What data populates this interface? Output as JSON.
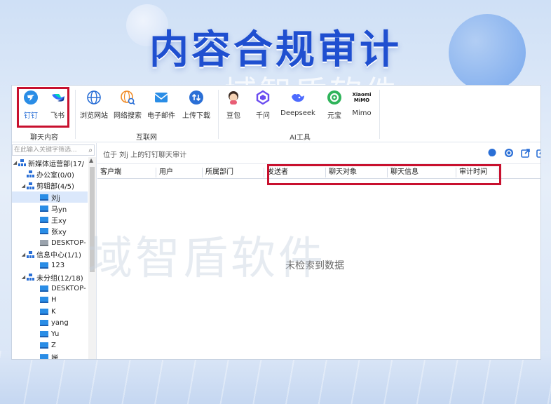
{
  "banner": {
    "title": "内容合规审计",
    "watermark_top": "域智盾软件"
  },
  "ribbon": {
    "groups": [
      {
        "label": "聊天内容",
        "items": [
          {
            "label": "钉钉",
            "icon": "dingtalk-icon"
          },
          {
            "label": "飞书",
            "icon": "feishu-icon"
          }
        ]
      },
      {
        "label": "互联网",
        "items": [
          {
            "label": "浏览网站",
            "icon": "globe-icon"
          },
          {
            "label": "网络搜索",
            "icon": "web-search-icon"
          },
          {
            "label": "电子邮件",
            "icon": "mail-icon"
          },
          {
            "label": "上传下载",
            "icon": "upload-download-icon"
          }
        ]
      },
      {
        "label": "AI工具",
        "items": [
          {
            "label": "豆包",
            "icon": "doubao-icon"
          },
          {
            "label": "千问",
            "icon": "qianwen-icon"
          },
          {
            "label": "Deepseek",
            "icon": "deepseek-icon"
          },
          {
            "label": "元宝",
            "icon": "yuanbao-icon"
          },
          {
            "label": "Mimo",
            "icon": "xiaomi-mimo-icon",
            "logo_text": "Xiaomi MiMO"
          }
        ]
      }
    ]
  },
  "sidebar": {
    "search_placeholder": "在此输入关键字筛选...",
    "tree": [
      {
        "label": "新媒体运营部(17/",
        "type": "org",
        "level": 0,
        "expanded": true
      },
      {
        "label": "办公室(0/0)",
        "type": "org",
        "level": 1
      },
      {
        "label": "剪辑部(4/5)",
        "type": "org",
        "level": 1,
        "expanded": true
      },
      {
        "label": "刘j",
        "type": "pc",
        "level": 2,
        "online": true,
        "selected": true
      },
      {
        "label": "马yn",
        "type": "pc",
        "level": 2,
        "online": true
      },
      {
        "label": "王xy",
        "type": "pc",
        "level": 2,
        "online": true
      },
      {
        "label": "张xy",
        "type": "pc",
        "level": 2,
        "online": true
      },
      {
        "label": "DESKTOP-",
        "type": "pc",
        "level": 2,
        "online": false
      },
      {
        "label": "信息中心(1/1)",
        "type": "org",
        "level": 1,
        "expanded": true
      },
      {
        "label": "123",
        "type": "pc",
        "level": 2,
        "online": true
      },
      {
        "label": "未分组(12/18)",
        "type": "org",
        "level": 1,
        "expanded": true
      },
      {
        "label": "DESKTOP-",
        "type": "pc",
        "level": 2,
        "online": true
      },
      {
        "label": "H",
        "type": "pc",
        "level": 2,
        "online": true
      },
      {
        "label": "K",
        "type": "pc",
        "level": 2,
        "online": true
      },
      {
        "label": "yang",
        "type": "pc",
        "level": 2,
        "online": true
      },
      {
        "label": "Yu",
        "type": "pc",
        "level": 2,
        "online": true
      },
      {
        "label": "Z",
        "type": "pc",
        "level": 2,
        "online": true
      },
      {
        "label": "婵",
        "type": "pc",
        "level": 2,
        "online": true
      }
    ]
  },
  "main": {
    "info": "位于 刘j 上的钉钉聊天审计",
    "columns": [
      "客户端",
      "用户",
      "所属部门",
      "发送者",
      "聊天对象",
      "聊天信息",
      "审计时间"
    ],
    "empty_text": "未检索到数据",
    "watermark": "域智盾软件"
  },
  "colors": {
    "accent": "#1f4fd0",
    "highlight_box": "#c8102e"
  }
}
